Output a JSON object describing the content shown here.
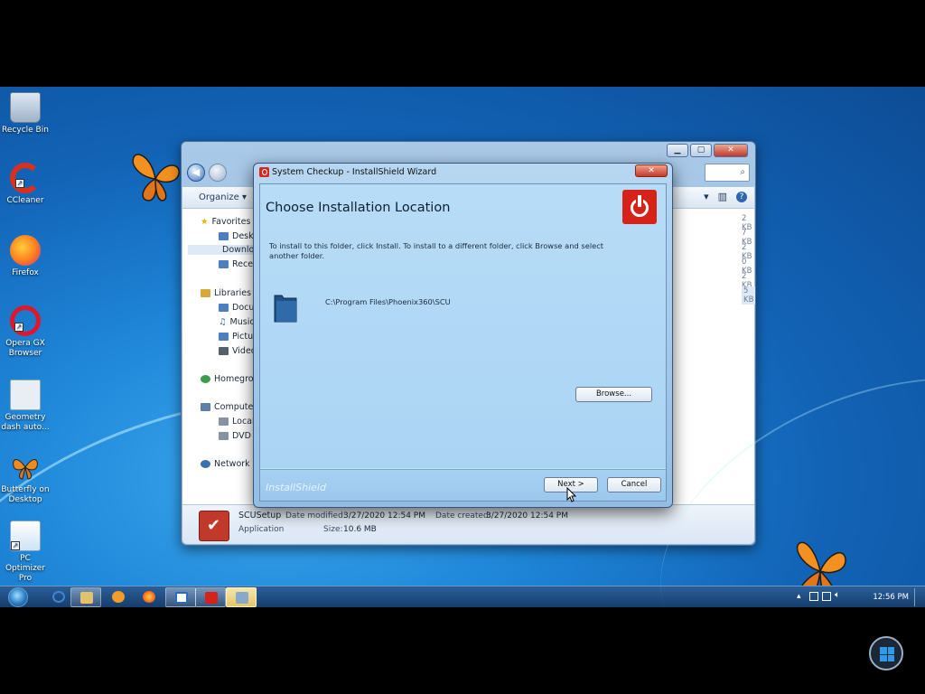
{
  "desktop": {
    "icons": [
      {
        "label": "Recycle Bin",
        "icon": "recycle-bin-icon"
      },
      {
        "label": "CCleaner",
        "icon": "ccleaner-icon"
      },
      {
        "label": "Firefox",
        "icon": "firefox-icon"
      },
      {
        "label": "Opera GX Browser",
        "icon": "opera-gx-icon"
      },
      {
        "label": "Geometry dash auto...",
        "icon": "geometry-dash-icon"
      },
      {
        "label": "Butterfly on Desktop",
        "icon": "butterfly-icon"
      },
      {
        "label": "PC Optimizer Pro",
        "icon": "pc-optimizer-icon"
      }
    ]
  },
  "explorer": {
    "toolbar": {
      "organize": "Organize ▾"
    },
    "nav": {
      "favorites": "Favorites",
      "desktop": "Desktop",
      "downloads": "Downloa",
      "recent": "Recent P",
      "libraries": "Libraries",
      "documents": "Documer",
      "music": "Music",
      "pictures": "Pictures",
      "videos": "Videos",
      "homegroup": "Homegrou",
      "computer": "Computer",
      "local_disk": "Local Dis",
      "dvd_drive": "DVD Driv",
      "network": "Network"
    },
    "sizes": [
      "2 KB",
      "7 KB",
      "2 KB",
      "0 KB",
      "2 KB",
      "5 KB"
    ],
    "details": {
      "name": "SCUSetup",
      "modified_label": "Date modified:",
      "modified": "3/27/2020 12:54 PM",
      "created_label": "Date created:",
      "created": "3/27/2020 12:54 PM",
      "type": "Application",
      "size_label": "Size:",
      "size": "10.6 MB"
    }
  },
  "dialog": {
    "title": "System Checkup - InstallShield Wizard",
    "close": "✕",
    "heading": "Choose Installation Location",
    "instruction": "To install to this folder, click Install. To install to a different folder, click Browse and select another folder.",
    "path": "C:\\Program Files\\Phoenix360\\SCU",
    "browse": "Browse...",
    "brand": "InstallShield",
    "next": "Next >",
    "cancel": "Cancel"
  },
  "taskbar": {
    "clock": "12:56 PM"
  },
  "colors": {
    "accent": "#d72219",
    "desktop": "#1f86d8"
  }
}
